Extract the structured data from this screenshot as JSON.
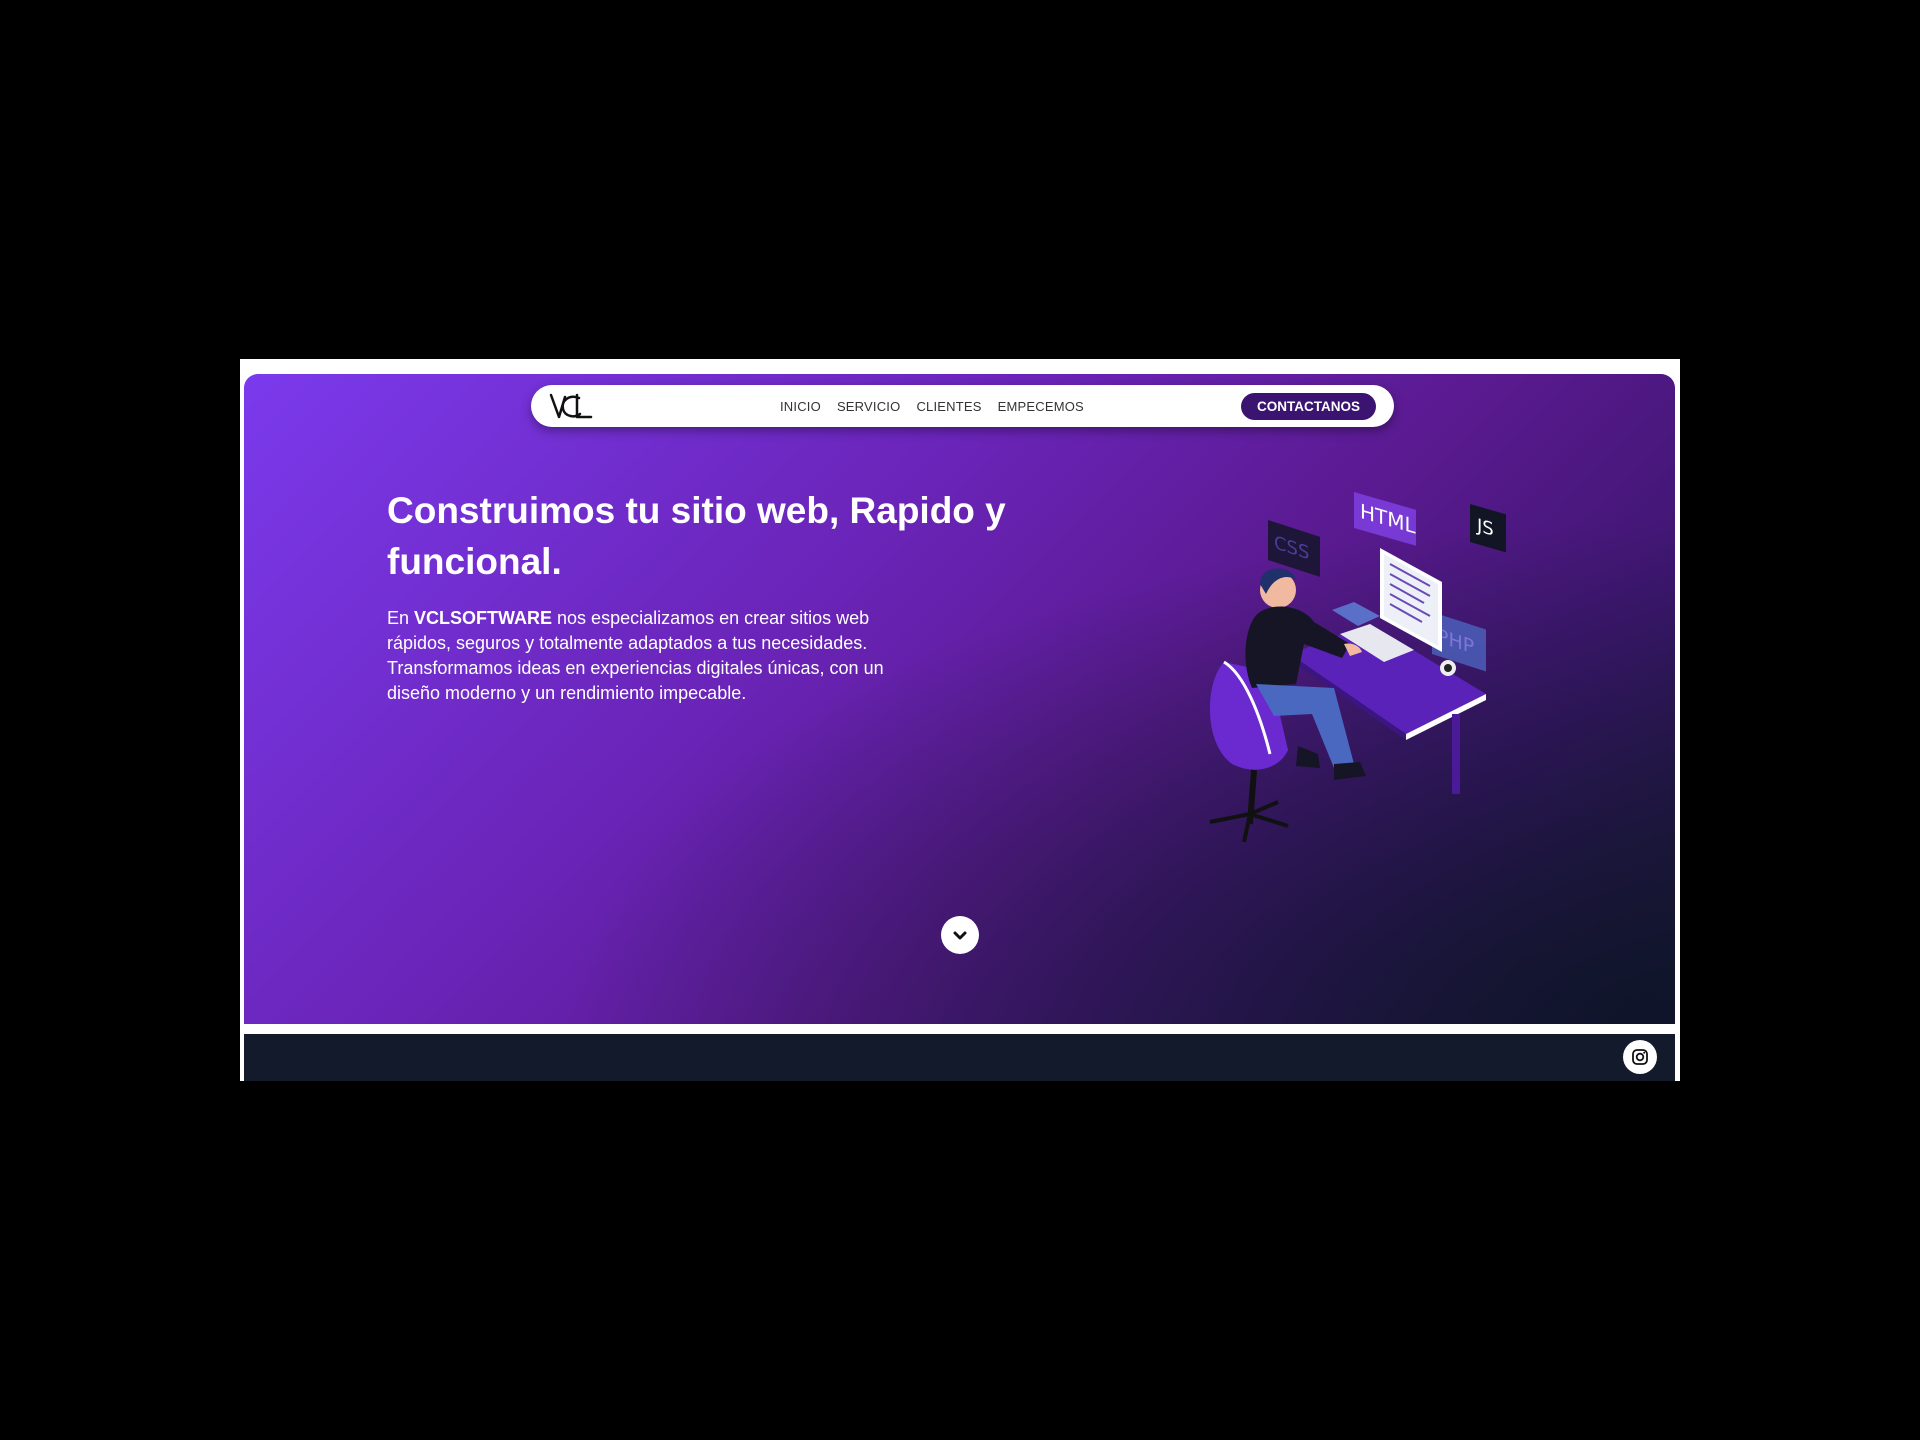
{
  "nav": {
    "logo_text": "VCL",
    "links": [
      "INICIO",
      "SERVICIO",
      "CLIENTES",
      "EMPECEMOS"
    ],
    "cta": "CONTACTANOS"
  },
  "hero": {
    "title_line1": "Construimos tu sitio web, Rapido y",
    "title_line2": "funcional.",
    "text_prefix": "En ",
    "brand": "VCLSOFTWARE",
    "text_rest": " nos especializamos en crear sitios web rápidos, seguros y totalmente adaptados a tus necesidades.",
    "text_line2": "Transformamos ideas en experiencias digitales únicas, con un diseño moderno y un rendimiento impecable.",
    "illustration_tags": [
      "HTML",
      "JS",
      "CSS",
      "PHP"
    ]
  },
  "icons": {
    "scroll": "chevron-down-icon",
    "social": "instagram-icon"
  },
  "colors": {
    "purple_light": "#7b3aec",
    "purple_dark": "#3a1470",
    "footer": "#121a2c"
  }
}
